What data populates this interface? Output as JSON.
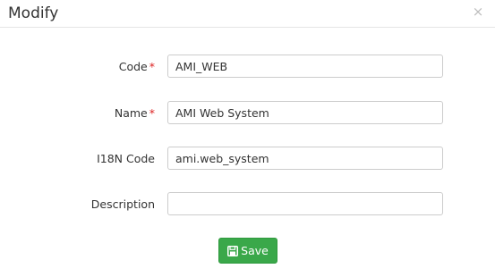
{
  "dialog": {
    "title": "Modify",
    "close_glyph": "×"
  },
  "form": {
    "fields": [
      {
        "label": "Code",
        "required_mark": "*",
        "value": "AMI_WEB",
        "placeholder": ""
      },
      {
        "label": "Name",
        "required_mark": "*",
        "value": "AMI Web System",
        "placeholder": ""
      },
      {
        "label": "I18N Code",
        "required_mark": "",
        "value": "ami.web_system",
        "placeholder": ""
      },
      {
        "label": "Description",
        "required_mark": "",
        "value": "",
        "placeholder": ""
      }
    ]
  },
  "actions": {
    "save_label": "Save",
    "save_icon": "floppy-disk-icon"
  },
  "colors": {
    "save_button": "#3aa84a",
    "required_mark": "#dd2222",
    "close_icon": "#bdbdbd"
  }
}
